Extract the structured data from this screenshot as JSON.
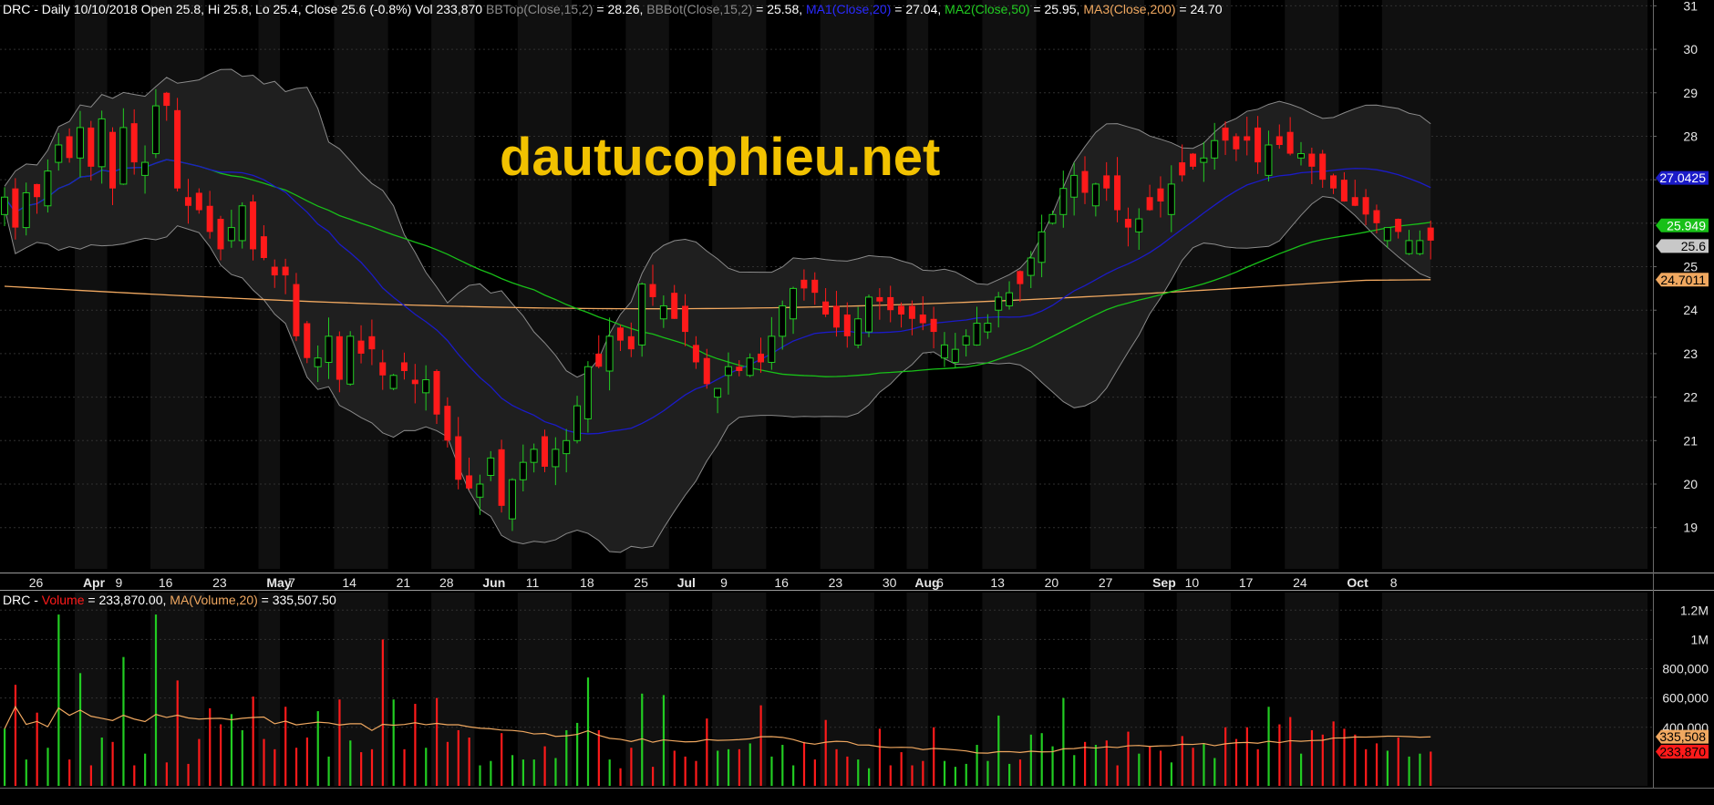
{
  "chart_data": {
    "type": "candlestick",
    "symbol": "DRC",
    "header": {
      "prefix": "DRC - Daily 10/10/2018 Open 25.8, Hi 25.8, Lo 25.4, Close 25.6 (-0.8%) Vol 233,870 ",
      "bbtop": "BBTop(Close,15,2)",
      "bbtop_val": " = 28.26, ",
      "bbbot": "BBBot(Close,15,2)",
      "bbbot_val": " = 25.58, ",
      "ma1": "MA1(Close,20)",
      "ma1_val": " = 27.04, ",
      "ma2": "MA2(Close,50)",
      "ma2_val": " = 25.95, ",
      "ma3": "MA3(Close,200)",
      "ma3_val": " = 24.70"
    },
    "volume_header": {
      "prefix": "DRC - ",
      "vol": "Volume",
      "vol_val": " = 233,870.00, ",
      "ma": "MA(Volume,20)",
      "ma_val": " = 335,507.50"
    },
    "watermark": "dautucophieu.net",
    "price_ticks": [
      19,
      20,
      21,
      22,
      23,
      24,
      25,
      26,
      27,
      28,
      29,
      30,
      31
    ],
    "ylim": [
      18.05,
      31.05
    ],
    "volume_ticks": [
      {
        "value": 400000,
        "label": "400,000"
      },
      {
        "value": 600000,
        "label": "600,000"
      },
      {
        "value": 800000,
        "label": "800,000"
      },
      {
        "value": 1000000,
        "label": "1M"
      },
      {
        "value": 1200000,
        "label": "1.2M"
      }
    ],
    "volume_max": 1320000,
    "x_tick_labels": [
      {
        "i": 2,
        "label": "26"
      },
      {
        "i": 7,
        "label": "Apr"
      },
      {
        "i": 10,
        "label": "9"
      },
      {
        "i": 14,
        "label": "16"
      },
      {
        "i": 19,
        "label": "23"
      },
      {
        "i": 24,
        "label": "May"
      },
      {
        "i": 26,
        "label": "7"
      },
      {
        "i": 31,
        "label": "14"
      },
      {
        "i": 36,
        "label": "21"
      },
      {
        "i": 40,
        "label": "28"
      },
      {
        "i": 44,
        "label": "Jun"
      },
      {
        "i": 48,
        "label": "11"
      },
      {
        "i": 53,
        "label": "18"
      },
      {
        "i": 58,
        "label": "25"
      },
      {
        "i": 62,
        "label": "Jul"
      },
      {
        "i": 66,
        "label": "9"
      },
      {
        "i": 71,
        "label": "16"
      },
      {
        "i": 76,
        "label": "23"
      },
      {
        "i": 81,
        "label": "30"
      },
      {
        "i": 84,
        "label": "Aug"
      },
      {
        "i": 86,
        "label": "6"
      },
      {
        "i": 91,
        "label": "13"
      },
      {
        "i": 96,
        "label": "20"
      },
      {
        "i": 101,
        "label": "27"
      },
      {
        "i": 106,
        "label": "Sep"
      },
      {
        "i": 109,
        "label": "10"
      },
      {
        "i": 114,
        "label": "17"
      },
      {
        "i": 119,
        "label": "24"
      },
      {
        "i": 124,
        "label": "Oct"
      },
      {
        "i": 128,
        "label": "8"
      }
    ],
    "last_value_tags": [
      {
        "value": 27.0425,
        "label": "27.0425",
        "color": "#1b1bc8",
        "text": "#ffffff"
      },
      {
        "value": 25.949,
        "label": "25.949",
        "color": "#18c018",
        "text": "#ffffff"
      },
      {
        "value": 25.6,
        "label": "25.6",
        "color": "#c8c8c8",
        "text": "#000000"
      },
      {
        "value": 24.7011,
        "label": "24.7011",
        "color": "#f0a860",
        "text": "#000000"
      }
    ],
    "volume_tags": [
      {
        "value": 335508,
        "label": "335,508",
        "color": "#f0a860",
        "text": "#000000"
      },
      {
        "value": 233870,
        "label": "233,870",
        "color": "#ff1a1a",
        "text": "#000000"
      }
    ],
    "colors": {
      "up": "#22cc22",
      "down": "#ff1a1a",
      "ma1": "#1b1bc8",
      "ma2": "#18c018",
      "ma3": "#f0a860",
      "bb": "#8a8a8a",
      "bbfill": "#262626",
      "bg": "#000000",
      "grid": "#303030",
      "text": "#e6e6e6",
      "bbtop_label": "#8a8a8a",
      "bbbot_label": "#8a8a8a",
      "vol_ma": "#f0a860"
    },
    "ohlc_close": [
      26.6,
      25.9,
      26.7,
      26.6,
      27.2,
      27.8,
      27.5,
      28.2,
      27.3,
      28.4,
      26.8,
      28.2,
      27.4,
      27.4,
      28.7,
      28.7,
      26.8,
      26.4,
      26.3,
      25.8,
      25.4,
      25.9,
      26.4,
      25.4,
      25.2,
      24.8,
      24.8,
      23.4,
      22.9,
      22.9,
      23.4,
      22.4,
      23.4,
      23.0,
      23.1,
      22.5,
      22.5,
      22.6,
      22.3,
      22.4,
      21.6,
      21.0,
      20.1,
      19.9,
      20.0,
      20.6,
      19.5,
      20.1,
      20.5,
      20.8,
      20.4,
      20.8,
      21.0,
      21.8,
      22.7,
      22.7,
      23.4,
      23.3,
      23.1,
      24.6,
      24.3,
      24.1,
      23.8,
      23.5,
      22.8,
      22.3,
      22.2,
      22.7,
      22.6,
      22.9,
      22.8,
      23.4,
      24.1,
      24.5,
      24.5,
      24.4,
      23.9,
      23.6,
      23.4,
      23.8,
      24.3,
      24.2,
      24.0,
      23.9,
      23.8,
      23.7,
      23.5,
      23.2,
      23.1,
      23.4,
      23.7,
      23.7,
      24.3,
      24.4,
      24.6,
      25.2,
      25.8,
      26.2,
      26.8,
      27.1,
      26.7,
      26.9,
      26.8,
      26.3,
      25.9,
      26.1,
      26.3,
      26.5,
      26.9,
      27.1,
      27.3,
      27.5,
      27.9,
      27.9,
      27.7,
      27.9,
      27.4,
      27.8,
      27.8,
      27.6,
      27.6,
      27.3,
      27.0,
      26.8,
      26.5,
      26.4,
      26.2,
      26.0,
      25.9,
      25.8,
      25.6,
      25.6,
      25.6
    ],
    "volume": [
      390000,
      690000,
      180000,
      500000,
      260000,
      1170000,
      180000,
      770000,
      140000,
      330000,
      300000,
      880000,
      140000,
      220000,
      1170000,
      160000,
      720000,
      150000,
      320000,
      530000,
      420000,
      490000,
      380000,
      610000,
      320000,
      250000,
      540000,
      260000,
      330000,
      510000,
      200000,
      590000,
      310000,
      230000,
      250000,
      1000000,
      590000,
      250000,
      560000,
      260000,
      600000,
      300000,
      380000,
      330000,
      140000,
      170000,
      360000,
      210000,
      180000,
      180000,
      270000,
      190000,
      380000,
      430000,
      740000,
      380000,
      180000,
      120000,
      260000,
      630000,
      130000,
      620000,
      240000,
      200000,
      170000,
      460000,
      240000,
      250000,
      250000,
      290000,
      550000,
      200000,
      280000,
      140000,
      300000,
      180000,
      450000,
      250000,
      200000,
      180000,
      120000,
      390000,
      140000,
      230000,
      140000,
      170000,
      400000,
      170000,
      130000,
      150000,
      280000,
      170000,
      480000,
      150000,
      180000,
      350000,
      360000,
      270000,
      600000,
      210000,
      300000,
      280000,
      310000,
      140000,
      370000,
      220000,
      270000,
      240000,
      160000,
      340000,
      260000,
      290000,
      190000,
      400000,
      320000,
      400000,
      250000,
      540000,
      420000,
      470000,
      220000,
      380000,
      350000,
      440000,
      390000,
      350000,
      250000,
      290000,
      240000,
      330000,
      200000,
      220000,
      233870
    ]
  }
}
